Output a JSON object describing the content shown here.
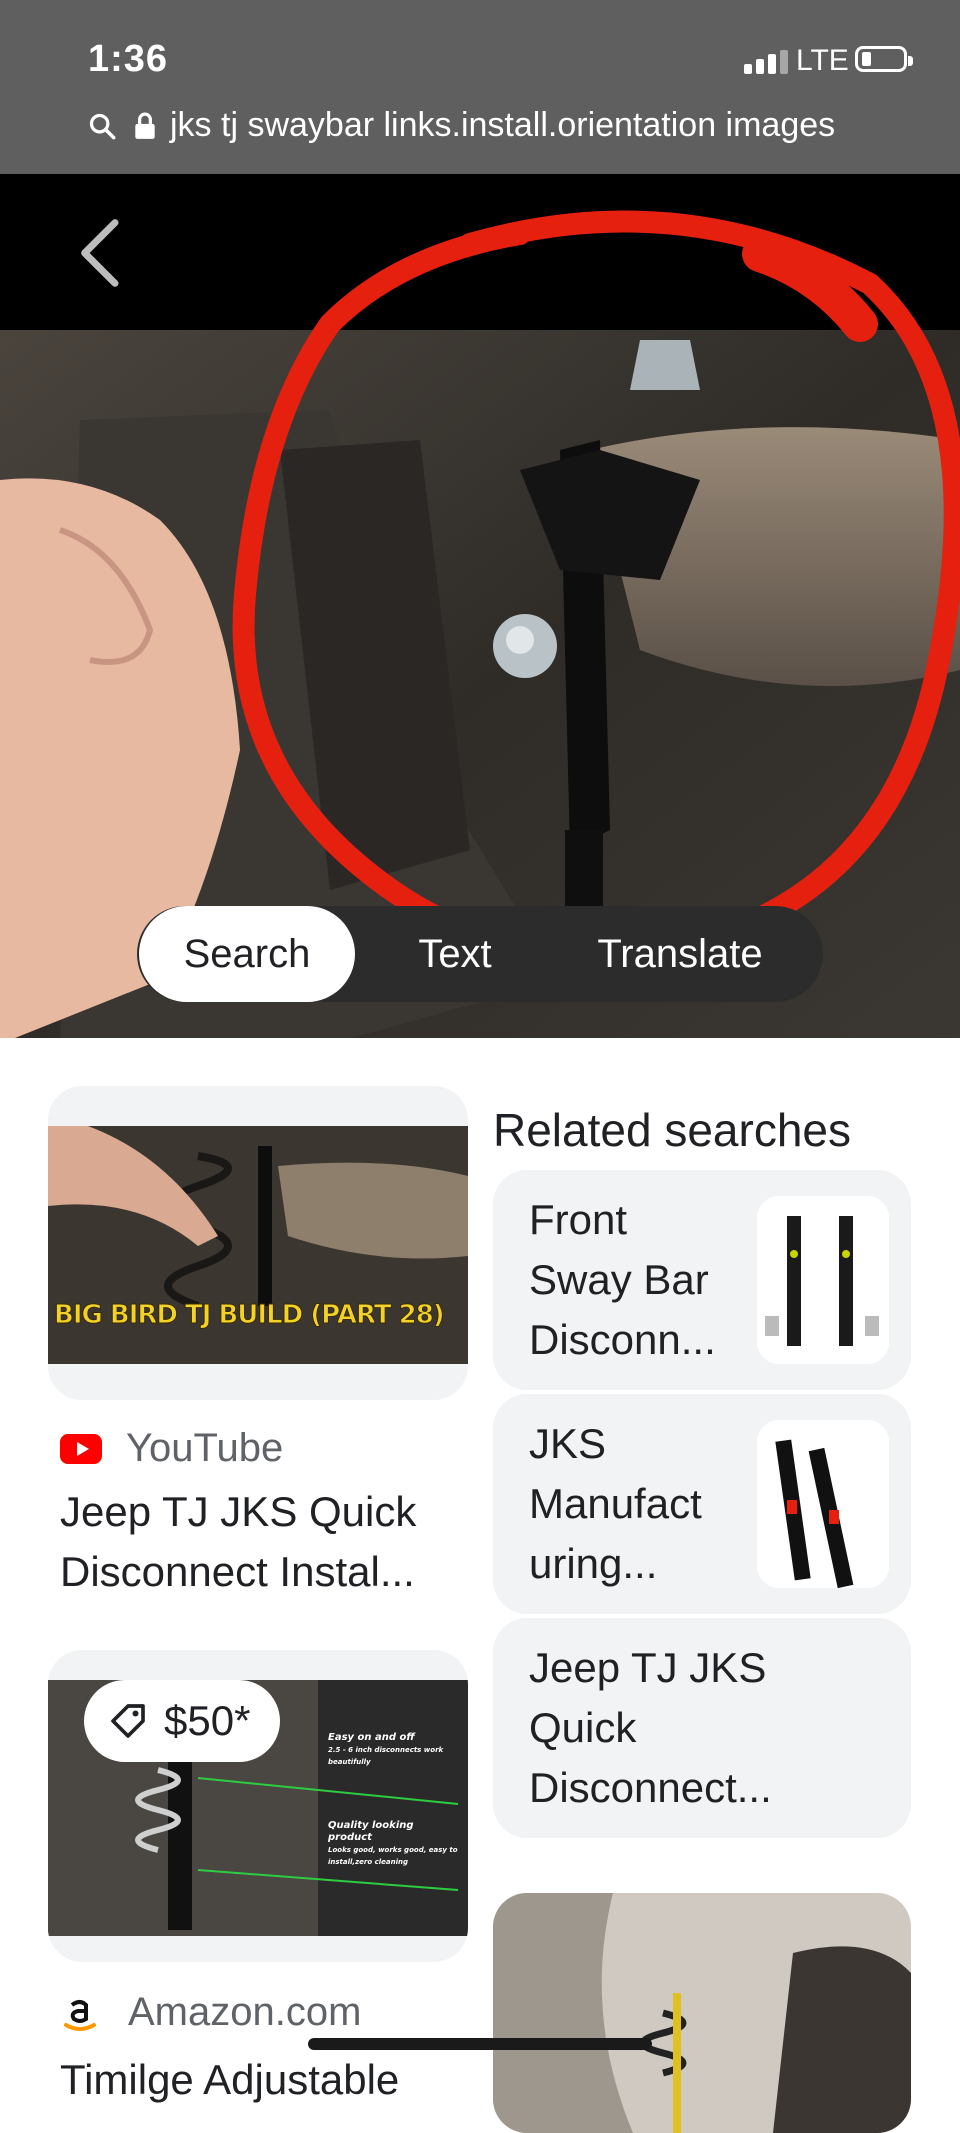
{
  "status_bar": {
    "time": "1:36",
    "network": "LTE"
  },
  "address_bar": {
    "query": "jks tj swaybar links.install.orientation images"
  },
  "lens": {
    "tabs": [
      {
        "label": "Search",
        "active": true
      },
      {
        "label": "Text"
      },
      {
        "label": "Translate"
      }
    ]
  },
  "results": [
    {
      "source": "YouTube",
      "title_line1": "Jeep TJ JKS Quick",
      "title_line2": "Disconnect Instal...",
      "thumbnail_caption": "BIG BIRD TJ BUILD (PART 28)"
    },
    {
      "source": "Amazon.com",
      "price": "$50*",
      "title_line1": "Timilge Adjustable",
      "thumbnail_text": [
        "Easy on and off",
        "2.5 - 6 inch disconnects work beautifully",
        "Quality looking product",
        "Looks good, works good, easy to install,zero cleaning"
      ]
    }
  ],
  "related": {
    "heading": "Related searches",
    "items": [
      {
        "line1": "Front",
        "line2": "Sway Bar",
        "line3": "Disconn..."
      },
      {
        "line1": "JKS",
        "line2": "Manufact",
        "line3": "uring..."
      },
      {
        "line1": "Jeep TJ JKS",
        "line2": "Quick",
        "line3": "Disconnect..."
      }
    ]
  },
  "colors": {
    "youtube_red": "#ff0000",
    "annotation_red": "#e6200f",
    "status_bar_bg": "#5f5f5f"
  }
}
